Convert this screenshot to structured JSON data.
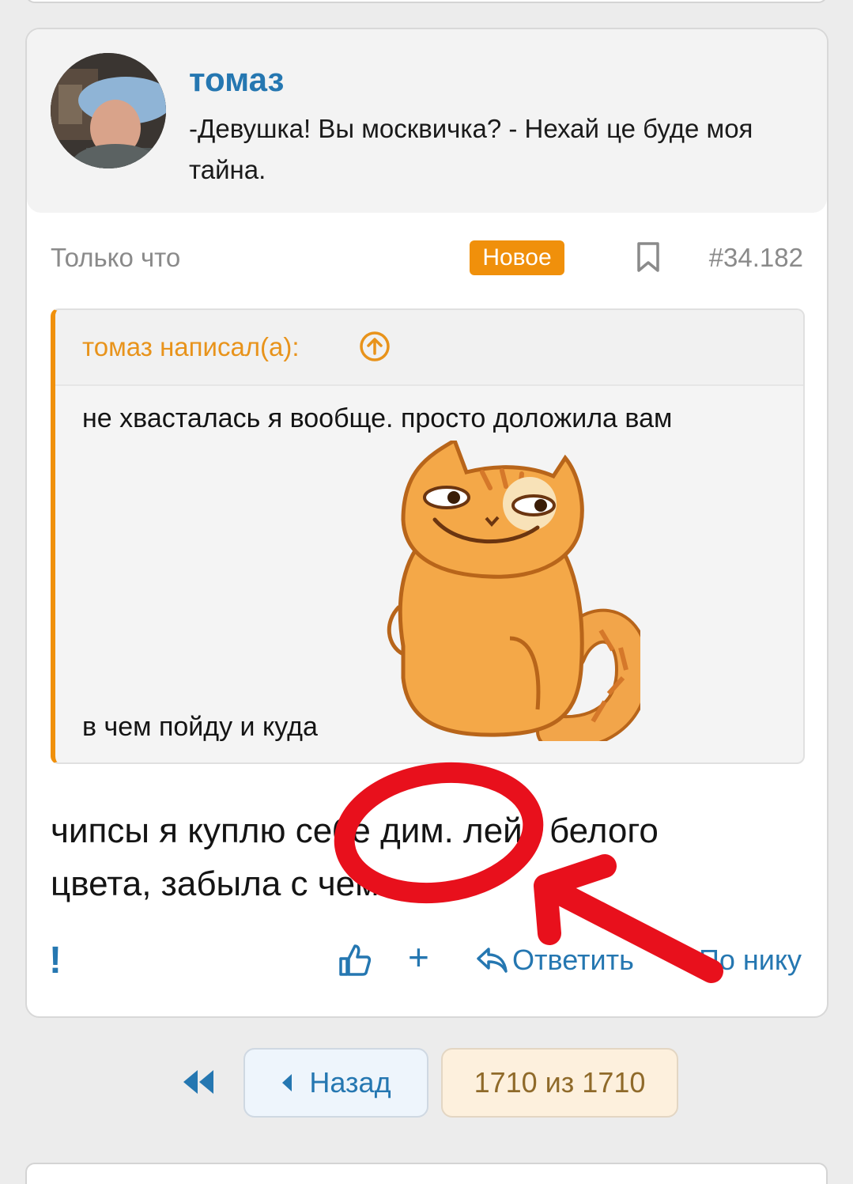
{
  "user": {
    "name": "томаз",
    "title": "-Девушка! Вы москвичка? - Нехай це буде моя тайна."
  },
  "meta": {
    "time": "Только что",
    "badge": "Новое",
    "post_number": "#34.182"
  },
  "quote": {
    "author": "томаз написал(а):",
    "line1": "не хвасталась я вообще. просто доложила вам",
    "line2": "в чем пойду и куда"
  },
  "post_text": "чипсы я куплю себе дим. лейс белого цвета, забыла с чем.",
  "actions": {
    "report": "!",
    "plus": "+",
    "reply": "Ответить",
    "by_nick": "По нику"
  },
  "pager": {
    "back": "Назад",
    "current": "1710 из 1710"
  },
  "colors": {
    "link_blue": "#2577b1",
    "accent_orange": "#f0900b",
    "annotation_red": "#e8101c"
  }
}
